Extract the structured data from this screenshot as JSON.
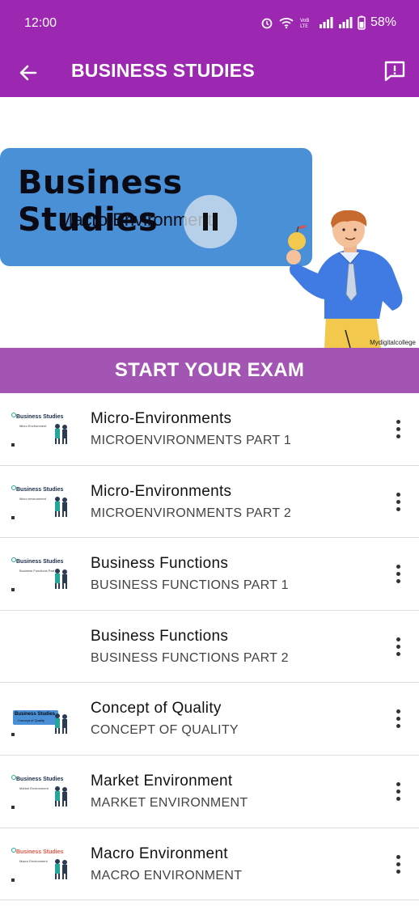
{
  "status_bar": {
    "time": "12:00",
    "battery": "58%",
    "icons": [
      "alarm-icon",
      "wifi-icon",
      "volte-icon",
      "signal-icon",
      "signal-icon",
      "battery-icon"
    ]
  },
  "app_bar": {
    "title": "BUSINESS STUDIES",
    "back_icon": "arrow-left-icon",
    "feedback_icon": "feedback-icon",
    "color": "#9c27b0"
  },
  "video": {
    "heading": "Business Studies",
    "subheading": "Macro Environment",
    "watermark": "Mydigitalcollege",
    "state_icon": "pause-icon"
  },
  "exam_button": {
    "label": "START YOUR EXAM",
    "color": "#a355b4"
  },
  "lessons": [
    {
      "title": "Micro-Environments",
      "subtitle": "MICROENVIRONMENTS PART 1",
      "thumb": {
        "style": "plain",
        "title": "Business Studies",
        "sub": "Micro Environment"
      }
    },
    {
      "title": "Micro-Environments",
      "subtitle": "MICROENVIRONMENTS PART 2",
      "thumb": {
        "style": "plain",
        "title": "Business Studies",
        "sub": "Micro environment"
      }
    },
    {
      "title": "Business Functions",
      "subtitle": "BUSINESS FUNCTIONS PART 1",
      "thumb": {
        "style": "plain",
        "title": "Business Studies",
        "sub": "Business Functions Part 1"
      }
    },
    {
      "title": "Business Functions",
      "subtitle": "BUSINESS FUNCTIONS PART 2",
      "thumb": {
        "style": "none",
        "title": "",
        "sub": ""
      }
    },
    {
      "title": "Concept of Quality",
      "subtitle": "CONCEPT OF QUALITY",
      "thumb": {
        "style": "blue",
        "title": "Business Studies",
        "sub": "Concept of Quality"
      }
    },
    {
      "title": "Market Environment",
      "subtitle": "MARKET ENVIRONMENT",
      "thumb": {
        "style": "plain",
        "title": "Business Studies",
        "sub": "Market Environment"
      }
    },
    {
      "title": "Macro Environment",
      "subtitle": "MACRO ENVIRONMENT",
      "thumb": {
        "style": "red",
        "title": "Business Studies",
        "sub": "Macro Environment"
      }
    }
  ],
  "row_menu_icon": "more-vertical-icon"
}
